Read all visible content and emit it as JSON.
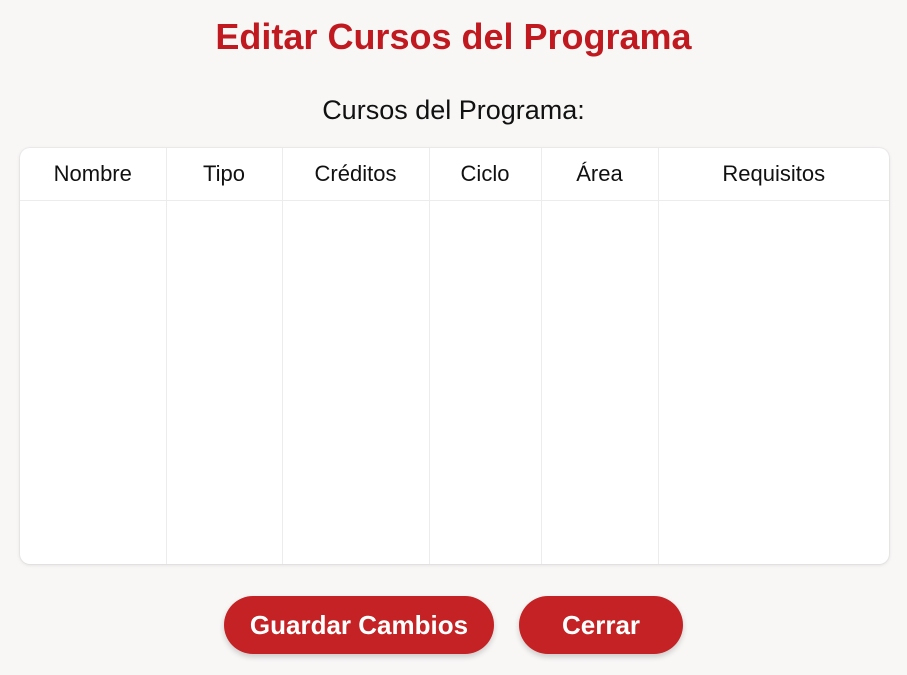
{
  "dialog": {
    "title": "Editar Cursos del Programa",
    "subtitle": "Cursos del Programa:"
  },
  "table": {
    "columns": [
      "Nombre",
      "Tipo",
      "Créditos",
      "Ciclo",
      "Área",
      "Requisitos"
    ],
    "rows": []
  },
  "actions": {
    "save_label": "Guardar Cambios",
    "close_label": "Cerrar"
  },
  "colors": {
    "accent": "#c0191f",
    "button": "#c42224",
    "background": "#f8f7f6"
  }
}
